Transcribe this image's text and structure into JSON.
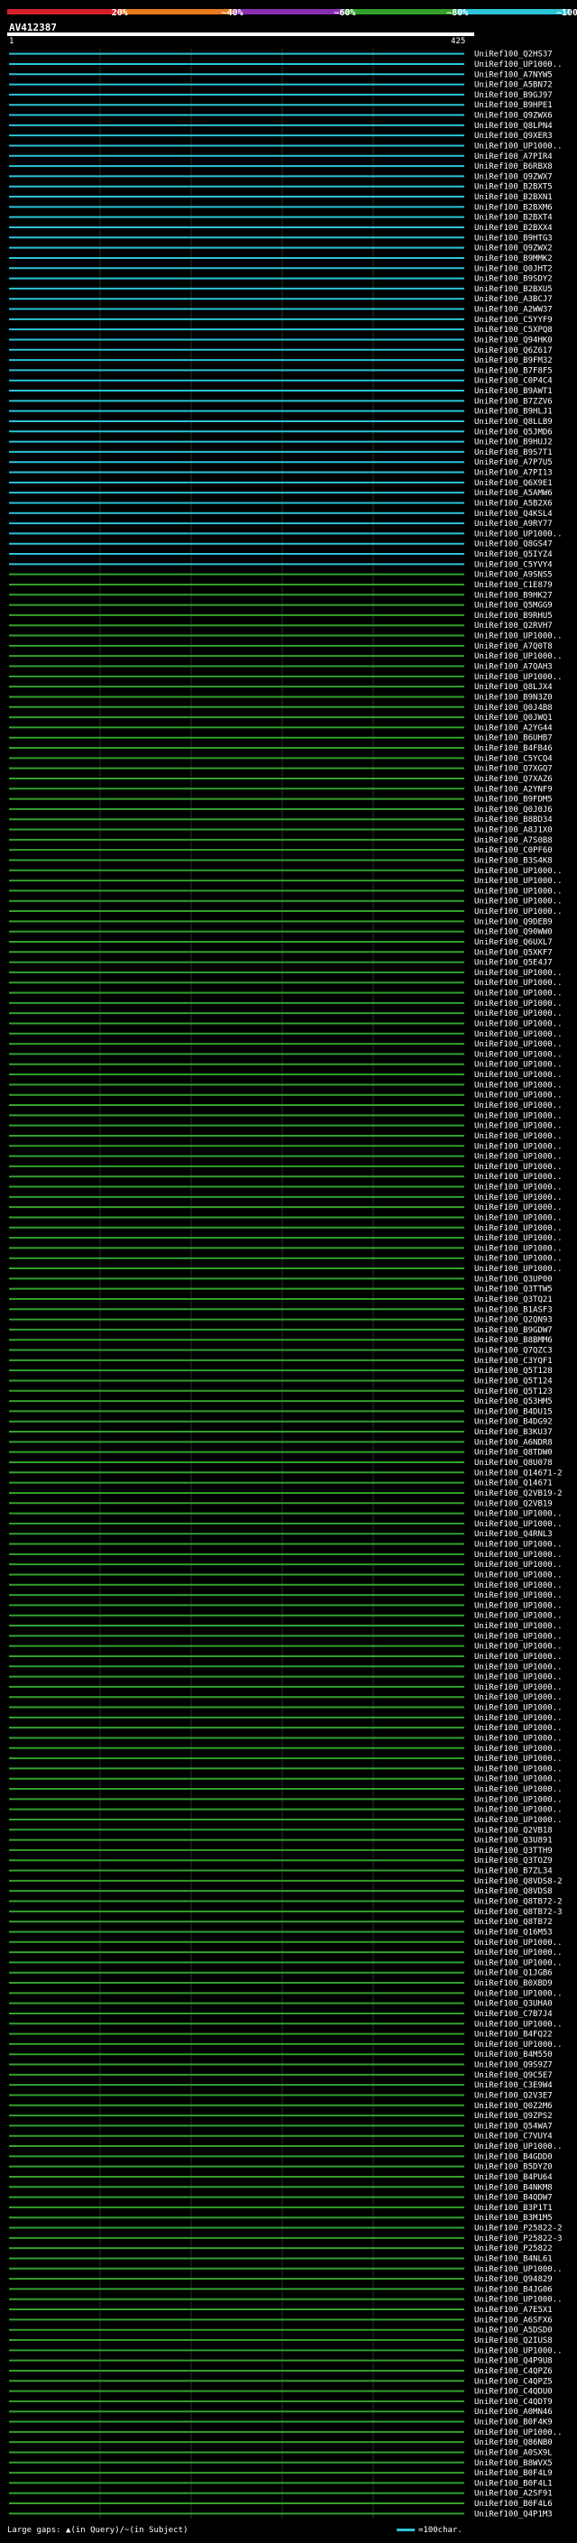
{
  "legend": {
    "ticks": [
      "20%",
      "~40%",
      "~60%",
      "~80%",
      "~100%"
    ],
    "colors": [
      "#d4202a",
      "#e87a1e",
      "#8a2fb0",
      "#33a02c",
      "#2bc4d8"
    ]
  },
  "query": {
    "title": "AV412387",
    "start": "1",
    "end": "425"
  },
  "footer": {
    "large_gaps": "Large gaps: ▲(in Query)/~(in Subject)",
    "scale": "=100char."
  },
  "chart_data": {
    "type": "alignment",
    "query_length": 425,
    "hits": [
      "UniRef100_Q2HS37",
      "UniRef100_UP1000..",
      "UniRef100_A7NYW5",
      "UniRef100_A5BN72",
      "UniRef100_B9GJ97",
      "UniRef100_B9HPE1",
      "UniRef100_Q9ZWX6",
      "UniRef100_Q8LPN4",
      "UniRef100_Q9XER3",
      "UniRef100_UP1000..",
      "UniRef100_A7PIR4",
      "UniRef100_B6RBX8",
      "UniRef100_Q9ZWX7",
      "UniRef100_B2BXT5",
      "UniRef100_B2BXN1",
      "UniRef100_B2BXM6",
      "UniRef100_B2BXT4",
      "UniRef100_B2BXX4",
      "UniRef100_B9HTG3",
      "UniRef100_Q9ZWX2",
      "UniRef100_B9MMK2",
      "UniRef100_Q0JHT2",
      "UniRef100_B9SDY2",
      "UniRef100_B2BXU5",
      "UniRef100_A3BCJ7",
      "UniRef100_A2WW37",
      "UniRef100_C5YYF9",
      "UniRef100_C5XPQ8",
      "UniRef100_Q94HK0",
      "UniRef100_Q6Z617",
      "UniRef100_B9FM32",
      "UniRef100_B7F8F5",
      "UniRef100_C0P4C4",
      "UniRef100_B9AWT1",
      "UniRef100_B7ZZV6",
      "UniRef100_B9HLJ1",
      "UniRef100_Q8LLB9",
      "UniRef100_Q5JMD6",
      "UniRef100_B9HUJ2",
      "UniRef100_B9S7T1",
      "UniRef100_A7P7U5",
      "UniRef100_A7PI13",
      "UniRef100_Q6X9E1",
      "UniRef100_A5AMW6",
      "UniRef100_A5B2X6",
      "UniRef100_Q4KSL4",
      "UniRef100_A9RY77",
      "UniRef100_UP1000..",
      "UniRef100_Q8GS47",
      "UniRef100_Q5IYZ4",
      "UniRef100_C5YVY4",
      "UniRef100_A9SNS5",
      "UniRef100_C1E879",
      "UniRef100_B9HK27",
      "UniRef100_Q5MGG9",
      "UniRef100_B9RHU5",
      "UniRef100_Q2RVH7",
      "UniRef100_UP1000..",
      "UniRef100_A7Q0T8",
      "UniRef100_UP1000..",
      "UniRef100_A7QAH3",
      "UniRef100_UP1000..",
      "UniRef100_Q8LJX4",
      "UniRef100_B9N3Z0",
      "UniRef100_Q0J4B8",
      "UniRef100_Q0JWQ1",
      "UniRef100_A2YG44",
      "UniRef100_B6UHB7",
      "UniRef100_B4FB46",
      "UniRef100_C5YCQ4",
      "UniRef100_Q7XGQ7",
      "UniRef100_Q7XAZ6",
      "UniRef100_A2YNF9",
      "UniRef100_B9FDM5",
      "UniRef100_Q0J0J6",
      "UniRef100_B8BD34",
      "UniRef100_A8J1X0",
      "UniRef100_A7S0B8",
      "UniRef100_C0PF60",
      "UniRef100_B3S4K8",
      "UniRef100_UP1000..",
      "UniRef100_UP1000..",
      "UniRef100_UP1000..",
      "UniRef100_UP1000..",
      "UniRef100_UP1000..",
      "UniRef100_Q9DEB9",
      "UniRef100_Q90WW0",
      "UniRef100_Q6UXL7",
      "UniRef100_Q5XKF7",
      "UniRef100_Q5E4J7",
      "UniRef100_UP1000..",
      "UniRef100_UP1000..",
      "UniRef100_UP1000..",
      "UniRef100_UP1000..",
      "UniRef100_UP1000..",
      "UniRef100_UP1000..",
      "UniRef100_UP1000..",
      "UniRef100_UP1000..",
      "UniRef100_UP1000..",
      "UniRef100_UP1000..",
      "UniRef100_UP1000..",
      "UniRef100_UP1000..",
      "UniRef100_UP1000..",
      "UniRef100_UP1000..",
      "UniRef100_UP1000..",
      "UniRef100_UP1000..",
      "UniRef100_UP1000..",
      "UniRef100_UP1000..",
      "UniRef100_UP1000..",
      "UniRef100_UP1000..",
      "UniRef100_UP1000..",
      "UniRef100_UP1000..",
      "UniRef100_UP1000..",
      "UniRef100_UP1000..",
      "UniRef100_UP1000..",
      "UniRef100_UP1000..",
      "UniRef100_UP1000..",
      "UniRef100_UP1000..",
      "UniRef100_UP1000..",
      "UniRef100_UP1000..",
      "UniRef100_Q3UP00",
      "UniRef100_Q3TTW5",
      "UniRef100_Q3TQ21",
      "UniRef100_B1ASF3",
      "UniRef100_Q2QN93",
      "UniRef100_B9GDW7",
      "UniRef100_B8BMM6",
      "UniRef100_Q7QZC3",
      "UniRef100_C3YQF1",
      "UniRef100_Q5T128",
      "UniRef100_Q5T124",
      "UniRef100_Q5T123",
      "UniRef100_Q53HM5",
      "UniRef100_B4DU15",
      "UniRef100_B4DG92",
      "UniRef100_B3KU37",
      "UniRef100_A6NDR8",
      "UniRef100_Q8TDW0",
      "UniRef100_Q8U078",
      "UniRef100_Q14671-2",
      "UniRef100_Q14671",
      "UniRef100_Q2VB19-2",
      "UniRef100_Q2VB19",
      "UniRef100_UP1000..",
      "UniRef100_UP1000..",
      "UniRef100_Q4RNL3",
      "UniRef100_UP1000..",
      "UniRef100_UP1000..",
      "UniRef100_UP1000..",
      "UniRef100_UP1000..",
      "UniRef100_UP1000..",
      "UniRef100_UP1000..",
      "UniRef100_UP1000..",
      "UniRef100_UP1000..",
      "UniRef100_UP1000..",
      "UniRef100_UP1000..",
      "UniRef100_UP1000..",
      "UniRef100_UP1000..",
      "UniRef100_UP1000..",
      "UniRef100_UP1000..",
      "UniRef100_UP1000..",
      "UniRef100_UP1000..",
      "UniRef100_UP1000..",
      "UniRef100_UP1000..",
      "UniRef100_UP1000..",
      "UniRef100_UP1000..",
      "UniRef100_UP1000..",
      "UniRef100_UP1000..",
      "UniRef100_UP1000..",
      "UniRef100_UP1000..",
      "UniRef100_UP1000..",
      "UniRef100_UP1000..",
      "UniRef100_UP1000..",
      "UniRef100_UP1000..",
      "UniRef100_Q2VB18",
      "UniRef100_Q3U891",
      "UniRef100_Q3TTH9",
      "UniRef100_Q3TOZ9",
      "UniRef100_B7ZL34",
      "UniRef100_Q8VDS8-2",
      "UniRef100_Q8VDS8",
      "UniRef100_Q8TB72-2",
      "UniRef100_Q8TB72-3",
      "UniRef100_Q8TB72",
      "UniRef100_Q16M53",
      "UniRef100_UP1000..",
      "UniRef100_UP1000..",
      "UniRef100_UP1000..",
      "UniRef100_Q1JGB6",
      "UniRef100_B0XBD9",
      "UniRef100_UP1000..",
      "UniRef100_Q3UHA0",
      "UniRef100_C7B7J4",
      "UniRef100_UP1000..",
      "UniRef100_B4FQ22",
      "UniRef100_UP1000..",
      "UniRef100_B4M550",
      "UniRef100_Q9S9Z7",
      "UniRef100_Q9C5E7",
      "UniRef100_C3E9W4",
      "UniRef100_Q2V3E7",
      "UniRef100_Q0Z2M6",
      "UniRef100_Q9ZPS2",
      "UniRef100_Q54WA7",
      "UniRef100_C7VUY4",
      "UniRef100_UP1000..",
      "UniRef100_B4GDD0",
      "UniRef100_B5DYZ0",
      "UniRef100_B4PU64",
      "UniRef100_B4NKM8",
      "UniRef100_B4QDW7",
      "UniRef100_B3P1T1",
      "UniRef100_B3M1M5",
      "UniRef100_P25822-2",
      "UniRef100_P25822-3",
      "UniRef100_P25822",
      "UniRef100_B4NL61",
      "UniRef100_UP1000..",
      "UniRef100_Q94829",
      "UniRef100_B4JG06",
      "UniRef100_UP1000..",
      "UniRef100_A7E5X1",
      "UniRef100_A6SFX6",
      "UniRef100_A5DSD0",
      "UniRef100_Q2IUS8",
      "UniRef100_UP1000..",
      "UniRef100_Q4P9U8",
      "UniRef100_C4QPZ6",
      "UniRef100_C4QPZ5",
      "UniRef100_C4QDU0",
      "UniRef100_C4QDT9",
      "UniRef100_A0MN46",
      "UniRef100_B0F4K9",
      "UniRef100_UP1000..",
      "UniRef100_Q86NB0",
      "UniRef100_A0SX9L",
      "UniRef100_B8WVX5",
      "UniRef100_B0F4L9",
      "UniRef100_B0F4L1",
      "UniRef100_A2SF91",
      "UniRef100_B0F4L6",
      "UniRef100_Q4P1M3"
    ]
  }
}
